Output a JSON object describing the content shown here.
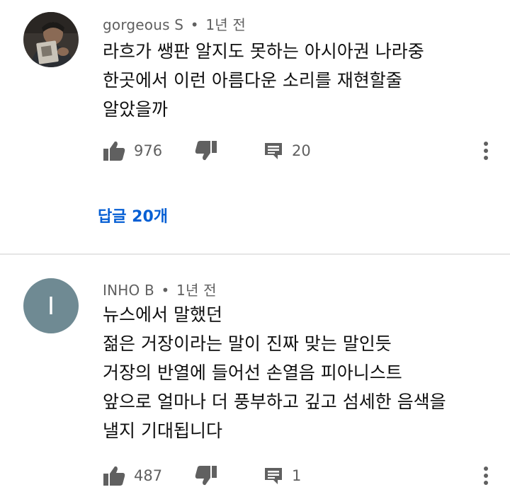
{
  "comments": [
    {
      "author": "gorgeous S",
      "separator": "•",
      "time": "1년 전",
      "lines": [
        "라흐가 쌩판 알지도 못하는 아시아권 나라중",
        "한곳에서 이런 아름다운 소리를 재현할줄",
        "알았을까"
      ],
      "likes": "976",
      "reply_count": "20",
      "replies_label": "답글 20개"
    },
    {
      "author": "INHO B",
      "separator": "•",
      "time": "1년 전",
      "avatar_letter": "I",
      "avatar_color": "#6f8a93",
      "lines": [
        "뉴스에서 말했던",
        "젊은 거장이라는 말이 진짜 맞는 말인듯",
        "거장의 반열에 들어선 손열음 피아니스트",
        "앞으로 얼마나 더 풍부하고 깊고 섬세한 음색을",
        "낼지 기대됩니다"
      ],
      "likes": "487",
      "reply_count": "1"
    }
  ],
  "colors": {
    "meta": "#606060",
    "link": "#065fd4",
    "icon": "#606060",
    "divider": "#e5e5e5"
  },
  "icons": [
    "thumb-up-icon",
    "thumb-down-icon",
    "reply-icon",
    "more-vertical-icon"
  ]
}
